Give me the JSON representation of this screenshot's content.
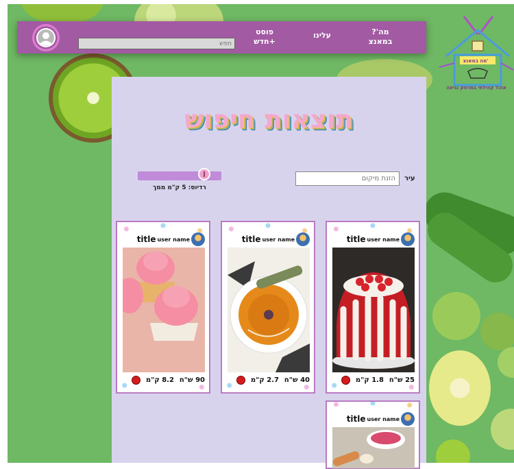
{
  "header": {
    "search_placeholder": "חפש",
    "nav": {
      "new_post": "פוסט\n+חדש",
      "about": "עלינו",
      "what_is": "מה'?\nבמאנצ"
    }
  },
  "logo": {
    "name": "מה במאנצ'",
    "tagline": "אוכל קהילתי במרחק נגיעה"
  },
  "main": {
    "title": "תוצאות חיפוש",
    "city_label": "עיר",
    "location_placeholder": "הזנת מיקום",
    "radius_label": "רדיוס: 5 ק\"מ ממך",
    "radius_km": 5
  },
  "cards": [
    {
      "title": "title",
      "user": "user name",
      "price": "25 ש\"ח",
      "distance": "1.8 ק\"מ",
      "image": "bundt-cake"
    },
    {
      "title": "title",
      "user": "user name",
      "price": "40 ש\"ח",
      "distance": "2.7 ק\"מ",
      "image": "soup"
    },
    {
      "title": "title",
      "user": "user name",
      "price": "90 ש\"ח",
      "distance": "8.2 ק\"מ",
      "image": "cupcakes"
    },
    {
      "title": "title",
      "user": "user name",
      "image": "soup-bowl"
    }
  ],
  "colors": {
    "header": "#a25aa3",
    "panel": "#d8d3ed",
    "background": "#6fb864",
    "status": "#d41c1c"
  }
}
